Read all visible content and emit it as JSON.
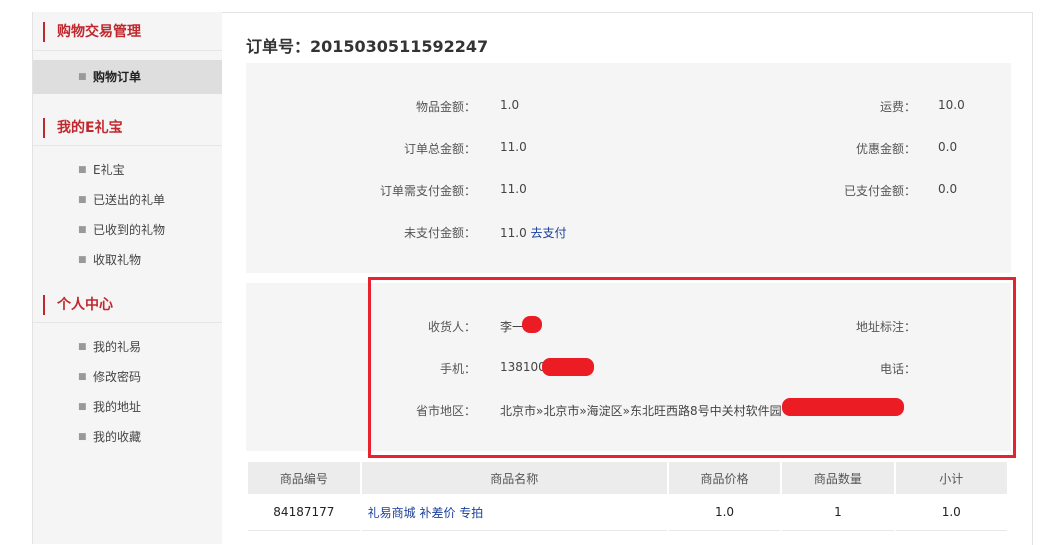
{
  "sidebar": {
    "sections": [
      {
        "title": "购物交易管理",
        "items": [
          "购物订单"
        ]
      },
      {
        "title": "我的E礼宝",
        "items": [
          "E礼宝",
          "已送出的礼单",
          "已收到的礼物",
          "收取礼物"
        ]
      },
      {
        "title": "个人中心",
        "items": [
          "我的礼易",
          "修改密码",
          "我的地址",
          "我的收藏"
        ]
      }
    ],
    "bullet": "■",
    "active_item": "购物订单"
  },
  "order": {
    "title": "订单号：2015030511592247"
  },
  "amounts": {
    "goods_label": "物品金额：",
    "goods_value": "1.0",
    "shipping_label": "运费：",
    "shipping_value": "10.0",
    "total_label": "订单总金额：",
    "total_value": "11.0",
    "discount_label": "优惠金额：",
    "discount_value": "0.0",
    "need_label": "订单需支付金额：",
    "need_value": "11.0",
    "paid_label": "已支付金额：",
    "paid_value": "0.0",
    "unpaid_label": "未支付金额：",
    "unpaid_value": "11.0",
    "pay_link": "去支付"
  },
  "delivery": {
    "receiver_label": "收货人：",
    "receiver_value": "李一",
    "note_label": "地址标注：",
    "note_value": "",
    "mobile_label": "手机：",
    "mobile_value": "138100",
    "phone_label": "电话：",
    "phone_value": "",
    "region_label": "省市地区：",
    "region_value": "北京市»北京市»海淀区»东北旺西路8号中关村软件园"
  },
  "table": {
    "headers": [
      "商品编号",
      "商品名称",
      "商品价格",
      "商品数量",
      "小计"
    ],
    "rows": [
      {
        "id": "84187177",
        "name": "礼易商城 补差价 专拍",
        "price": "1.0",
        "qty": "1",
        "subtotal": "1.0"
      }
    ]
  },
  "colors": {
    "accent": "#c0282e",
    "highlight": "#e8232f",
    "link": "#1a3e9b"
  }
}
